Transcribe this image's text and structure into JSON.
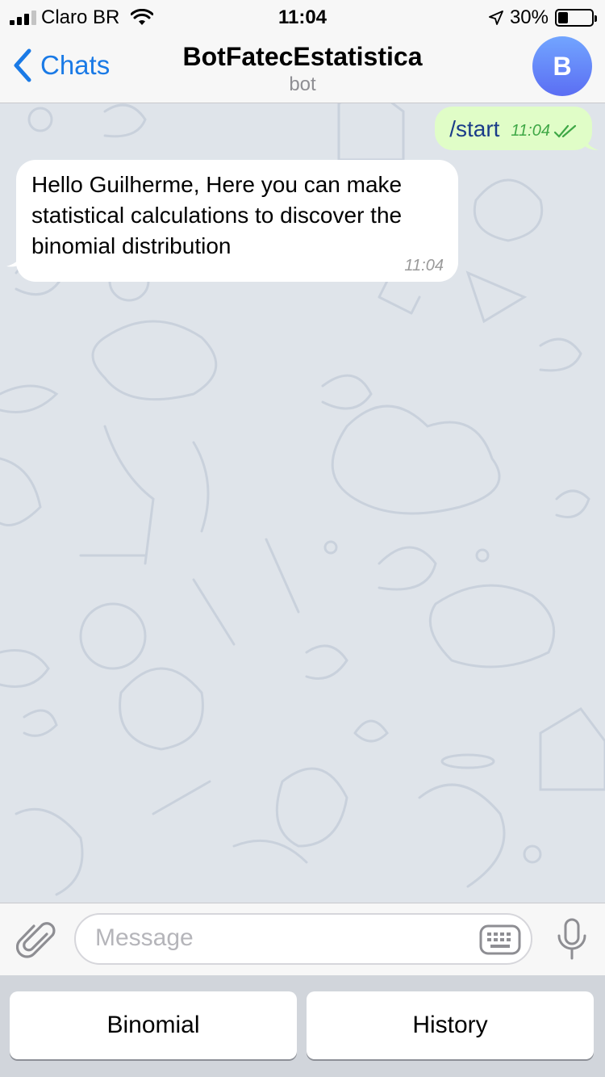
{
  "status_bar": {
    "carrier": "Claro BR",
    "time": "11:04",
    "battery": "30%",
    "battery_level": 0.3
  },
  "nav": {
    "back_label": "Chats",
    "title": "BotFatecEstatistica",
    "subtitle": "bot",
    "avatar_letter": "B"
  },
  "messages": {
    "outgoing": {
      "text": "/start",
      "time": "11:04",
      "status": "read"
    },
    "incoming": {
      "text": "Hello Guilherme, Here you can make statistical calculations to discover the binomial distribution",
      "time": "11:04"
    }
  },
  "input": {
    "placeholder": "Message"
  },
  "keyboard_buttons": [
    {
      "label": "Binomial"
    },
    {
      "label": "History"
    }
  ],
  "colors": {
    "accent": "#1a7ae6",
    "outgoing_bubble": "#e0fdc7",
    "incoming_bubble": "#ffffff",
    "chat_background": "#dfe4ea",
    "read_check": "#3fa846"
  }
}
